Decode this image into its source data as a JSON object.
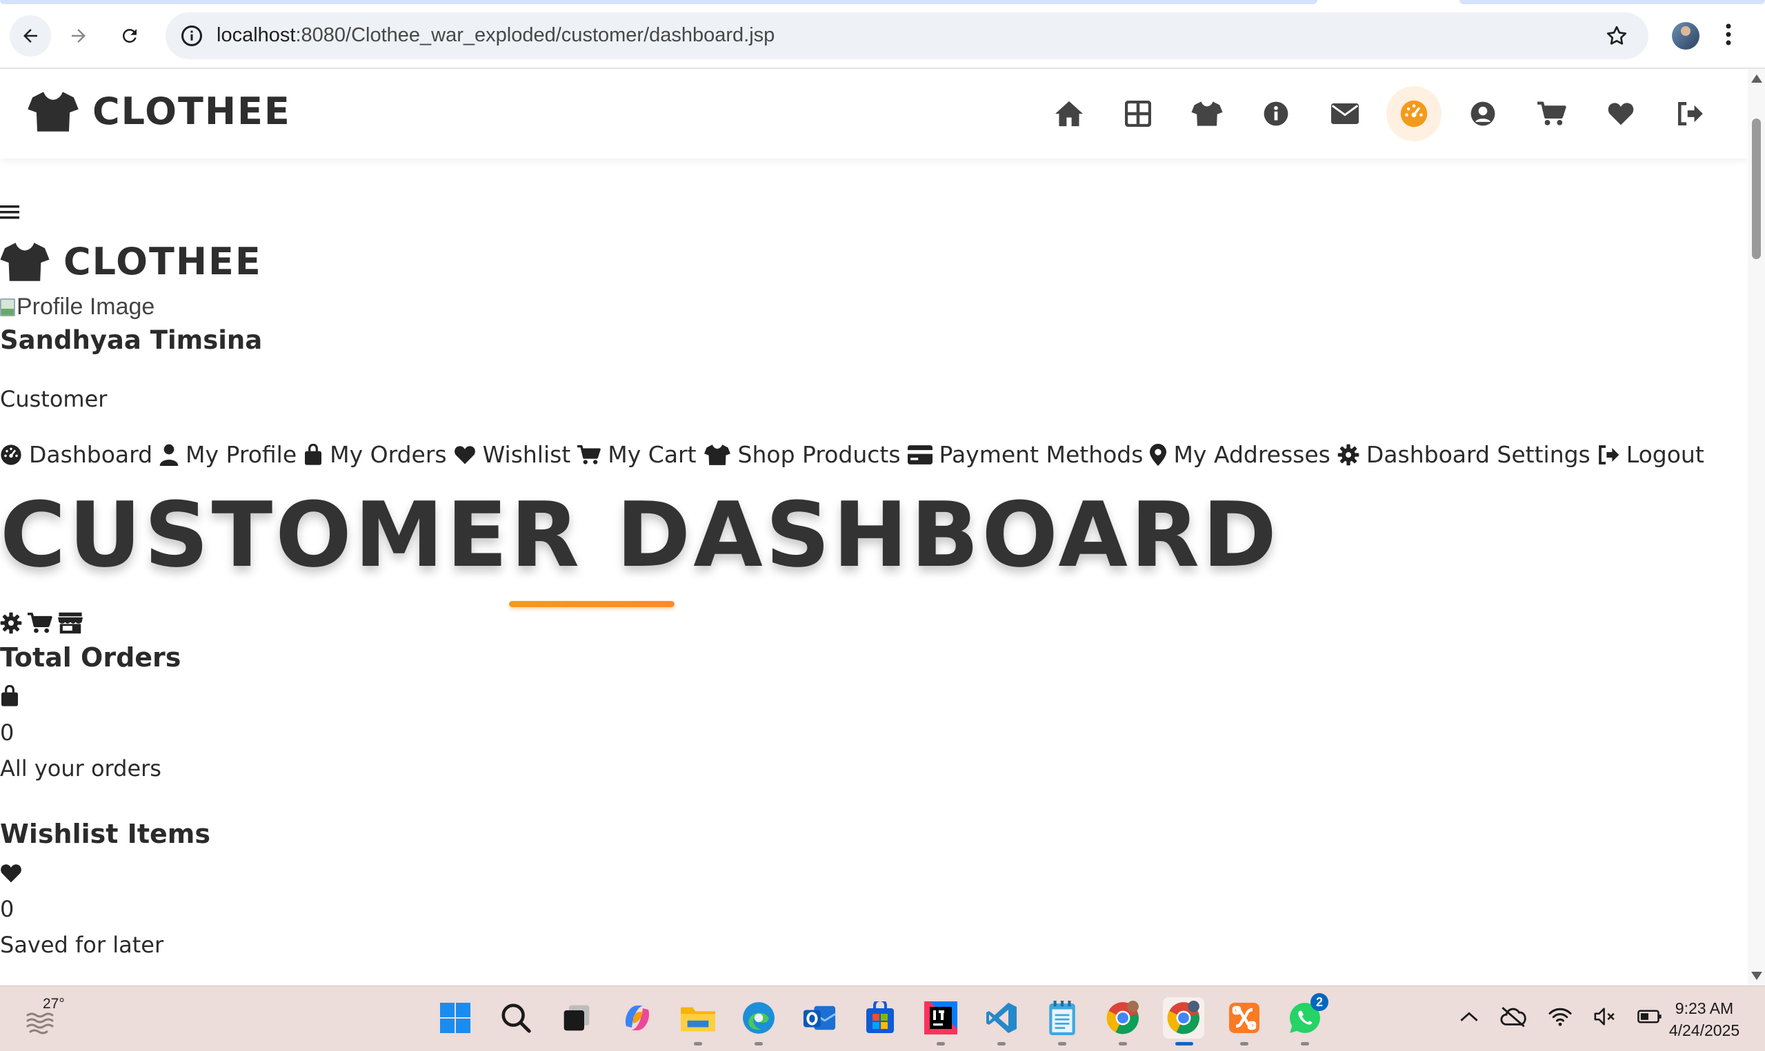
{
  "browser": {
    "url_host": "localhost",
    "url_path": ":8080/Clothee_war_exploded/customer/dashboard.jsp"
  },
  "site": {
    "brand": "CLOTHEE",
    "nav_icons": [
      "home-icon",
      "grid-icon",
      "shirt-icon",
      "info-icon",
      "envelope-icon",
      "dashboard-icon",
      "user-circle-icon",
      "cart-icon",
      "heart-icon",
      "logout-icon"
    ],
    "active_nav": "dashboard-icon",
    "accent_color": "#f39a1c"
  },
  "sidebar": {
    "brand": "CLOTHEE",
    "profile_image_alt": "Profile Image",
    "user_name": "Sandhyaa Timsina",
    "user_role": "Customer",
    "links": [
      {
        "label": "Dashboard",
        "icon": "dashboard-icon"
      },
      {
        "label": "My Profile",
        "icon": "user-icon"
      },
      {
        "label": "My Orders",
        "icon": "shopping-bag-icon"
      },
      {
        "label": "Wishlist",
        "icon": "heart-icon"
      },
      {
        "label": "My Cart",
        "icon": "cart-icon"
      },
      {
        "label": "Shop Products",
        "icon": "shirt-icon"
      },
      {
        "label": "Payment Methods",
        "icon": "credit-card-icon"
      },
      {
        "label": "My Addresses",
        "icon": "map-pin-icon"
      },
      {
        "label": "Dashboard Settings",
        "icon": "gear-icon"
      },
      {
        "label": "Logout",
        "icon": "logout-icon"
      }
    ]
  },
  "main": {
    "title": "CUSTOMER DASHBOARD",
    "quick_icons": [
      "gear-icon",
      "cart-icon",
      "store-icon"
    ],
    "stats": [
      {
        "title": "Total Orders",
        "icon": "shopping-bag-icon",
        "value": "0",
        "desc": "All your orders"
      },
      {
        "title": "Wishlist Items",
        "icon": "heart-icon",
        "value": "0",
        "desc": "Saved for later"
      }
    ]
  },
  "taskbar": {
    "weather_temp": "27°",
    "apps": [
      "windows-start",
      "search",
      "task-view",
      "copilot",
      "file-explorer",
      "edge",
      "outlook",
      "microsoft-store",
      "intellij",
      "vscode",
      "notepad",
      "chrome-profile-1",
      "chrome-profile-2",
      "xampp",
      "whatsapp"
    ],
    "whatsapp_badge": "2",
    "time": "9:23 AM",
    "date": "4/24/2025"
  }
}
